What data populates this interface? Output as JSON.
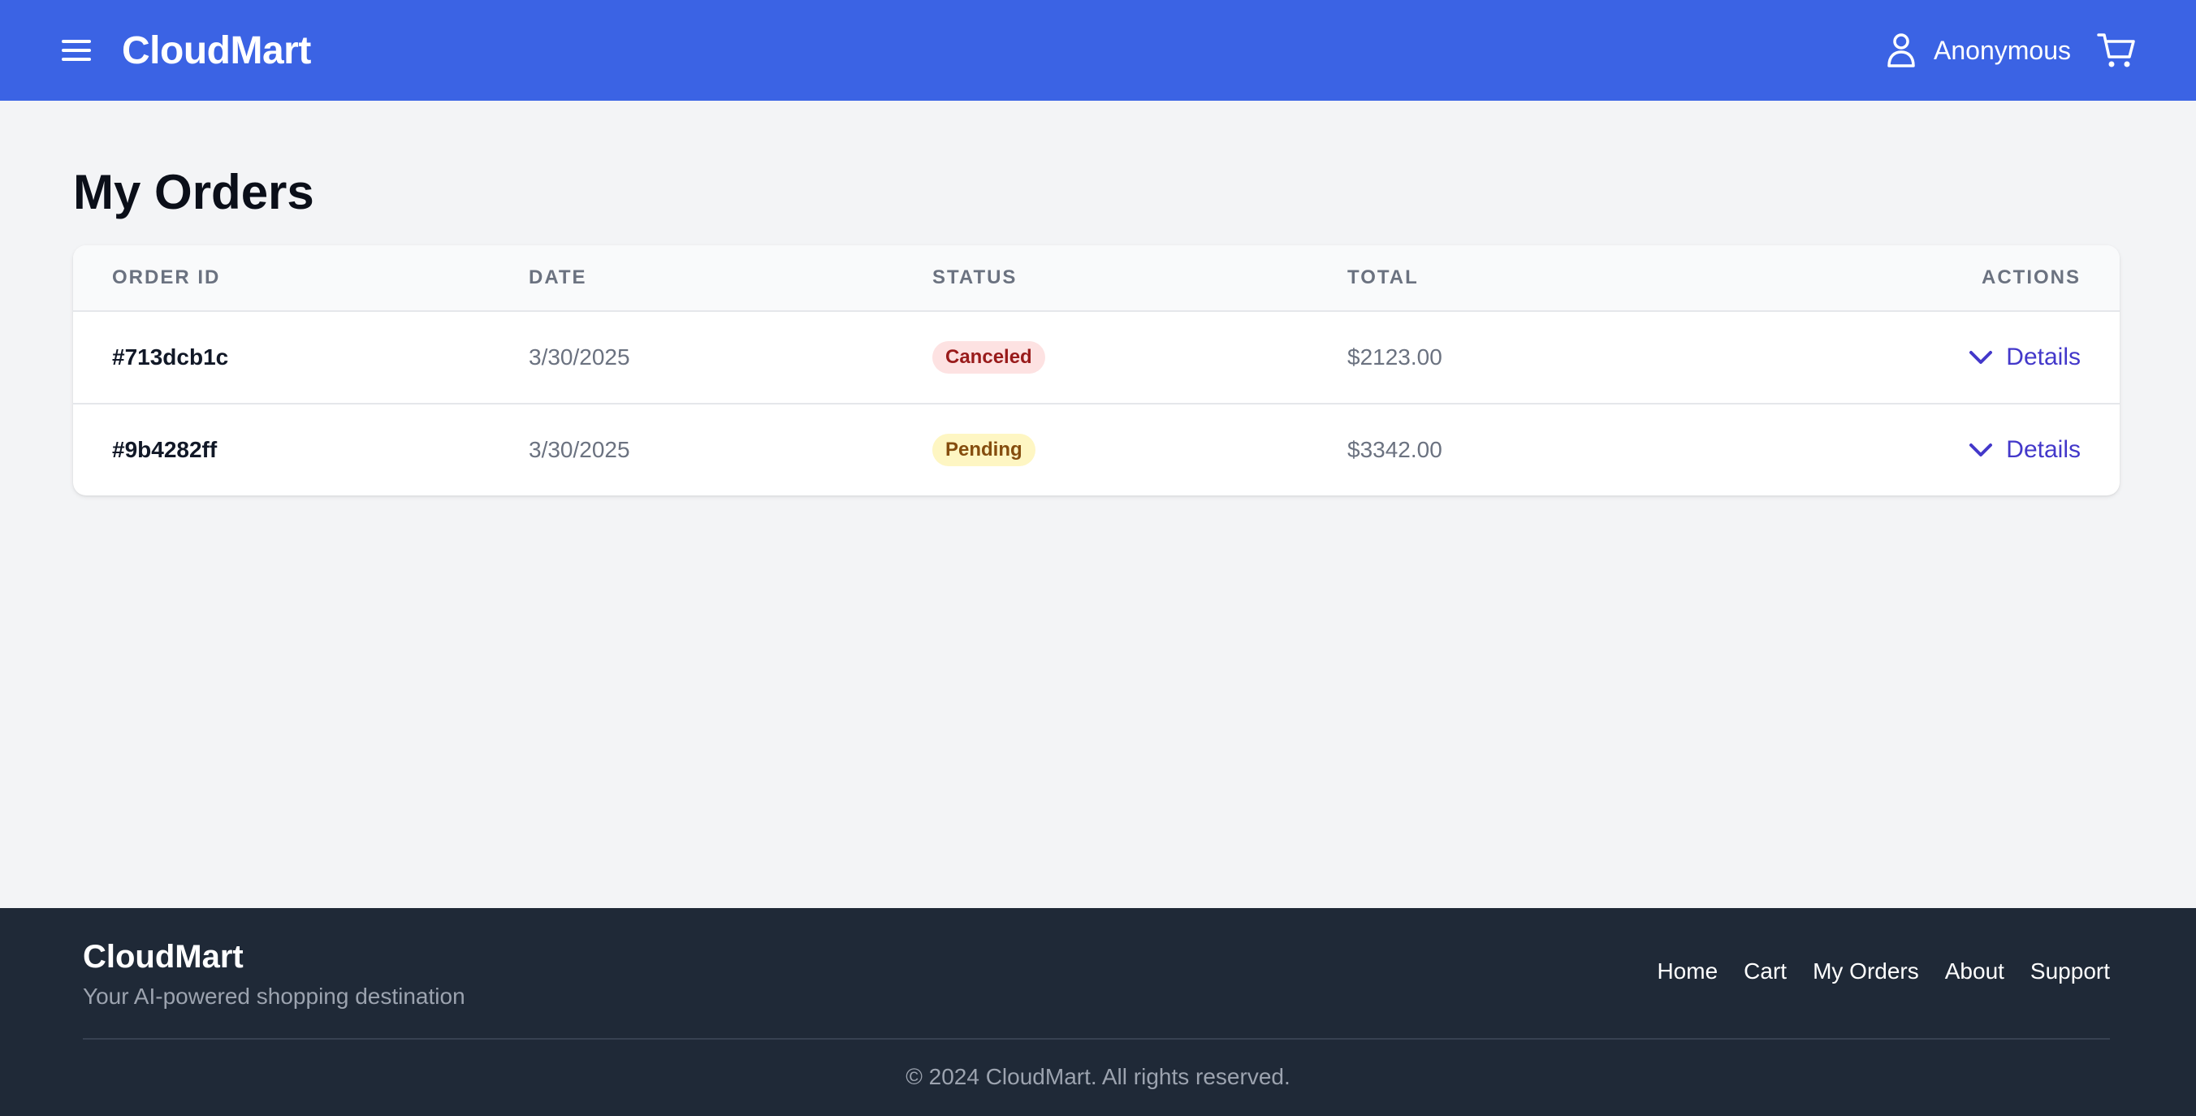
{
  "header": {
    "brand": "CloudMart",
    "user_name": "Anonymous"
  },
  "main": {
    "title": "My Orders",
    "columns": [
      "ORDER ID",
      "DATE",
      "STATUS",
      "TOTAL",
      "ACTIONS"
    ],
    "orders": [
      {
        "id": "#713dcb1c",
        "date": "3/30/2025",
        "status": "Canceled",
        "total": "$2123.00",
        "action": "Details"
      },
      {
        "id": "#9b4282ff",
        "date": "3/30/2025",
        "status": "Pending",
        "total": "$3342.00",
        "action": "Details"
      }
    ]
  },
  "footer": {
    "brand": "CloudMart",
    "tagline": "Your AI-powered shopping destination",
    "links": [
      "Home",
      "Cart",
      "My Orders",
      "About",
      "Support"
    ],
    "copyright": "© 2024 CloudMart. All rights reserved."
  },
  "colors": {
    "header_bg": "#3b63e4",
    "footer_bg": "#1f2937",
    "canceled_badge": "#fde2e2",
    "pending_badge": "#fef6c3",
    "link_accent": "#4338ca"
  },
  "icons": {
    "menu": "menu-icon",
    "user": "user-icon",
    "cart": "cart-icon",
    "details": "chevron-down-icon"
  }
}
